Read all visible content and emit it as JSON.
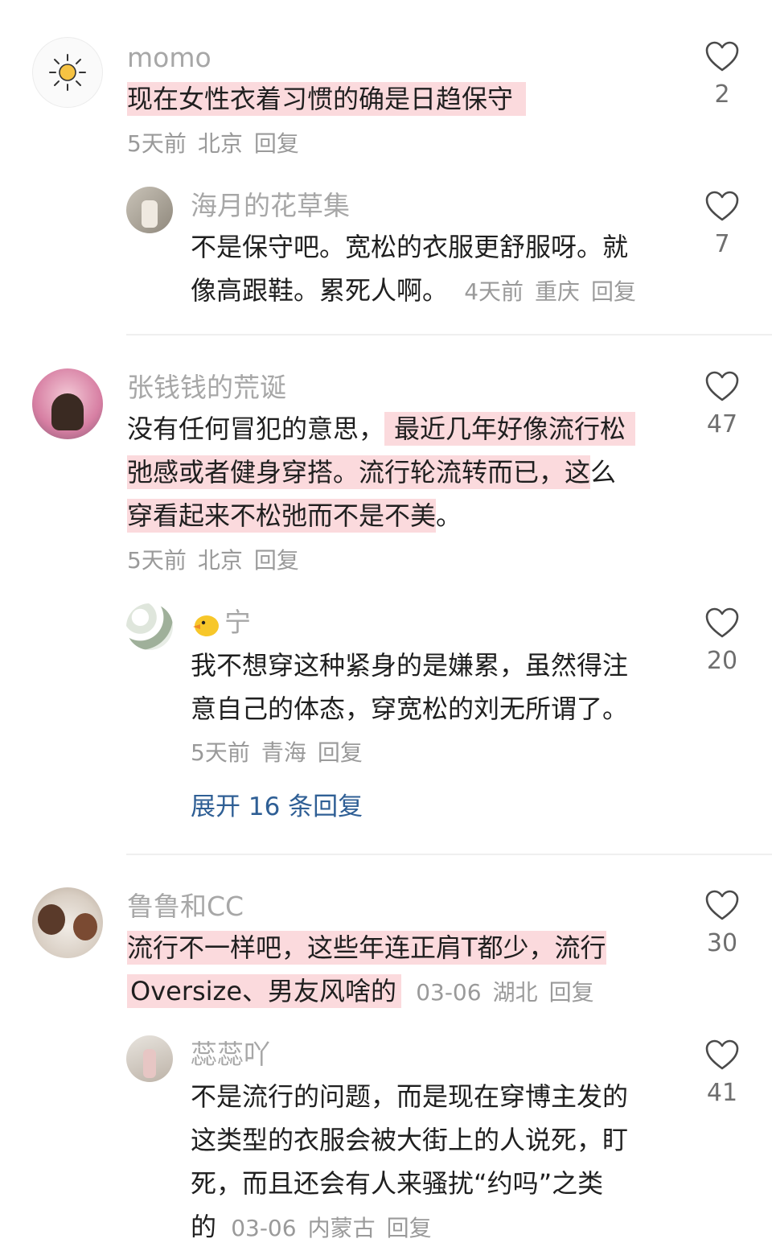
{
  "comments": [
    {
      "username": "momo",
      "text_lines": [
        [
          "现在女性衣着习惯的确是日趋保守"
        ]
      ],
      "time": "5天前",
      "location": "北京",
      "reply_label": "回复",
      "likes": "2",
      "reply": {
        "username": "海月的花草集",
        "text_line1": "不是保守吧。宽松的衣服更舒服呀。就",
        "text_line2": "像高跟鞋。累死人啊。",
        "time": "4天前",
        "location": "重庆",
        "reply_label": "回复",
        "likes": "7"
      }
    },
    {
      "username": "张钱钱的荒诞",
      "line1_plain": "没有任何冒犯的意思，",
      "line1_hl": "最近几年好像流行松",
      "line2_hl": "弛感或者健身穿搭。流行轮流转而已，这",
      "line2_plain": "么",
      "line3_hl": "穿看起来不松弛而不是不美",
      "line3_plain": "。",
      "time": "5天前",
      "location": "北京",
      "reply_label": "回复",
      "likes": "47",
      "reply": {
        "username_icon": "duck-emoji-icon",
        "username": "宁",
        "text_line1": "我不想穿这种紧身的是嫌累，虽然得注",
        "text_line2": "意自己的体态，穿宽松的刘无所谓了。",
        "time": "5天前",
        "location": "青海",
        "reply_label": "回复",
        "likes": "20"
      },
      "expand_label": "展开 16 条回复"
    },
    {
      "username": "鲁鲁和CC",
      "line1_hl": "流行不一样吧，这些年连正肩T都少，流行",
      "line2_hl": "Oversize、男友风啥的",
      "time": "03-06",
      "location": "湖北",
      "reply_label": "回复",
      "likes": "30",
      "reply": {
        "username": "蕊蕊吖",
        "text_line1": "不是流行的问题，而是现在穿博主发的",
        "text_line2": "这类型的衣服会被大街上的人说死，盯",
        "text_line3": "死，而且还会有人来骚扰“约吗”之类",
        "text_line4": "的",
        "time": "03-06",
        "location": "内蒙古",
        "reply_label": "回复",
        "likes": "41"
      }
    }
  ],
  "colors": {
    "highlight": "#fbdadd",
    "username": "#a7a7a7",
    "meta": "#9a9a9a",
    "link": "#2f5f95",
    "heart_stroke": "#4a4a4a"
  }
}
